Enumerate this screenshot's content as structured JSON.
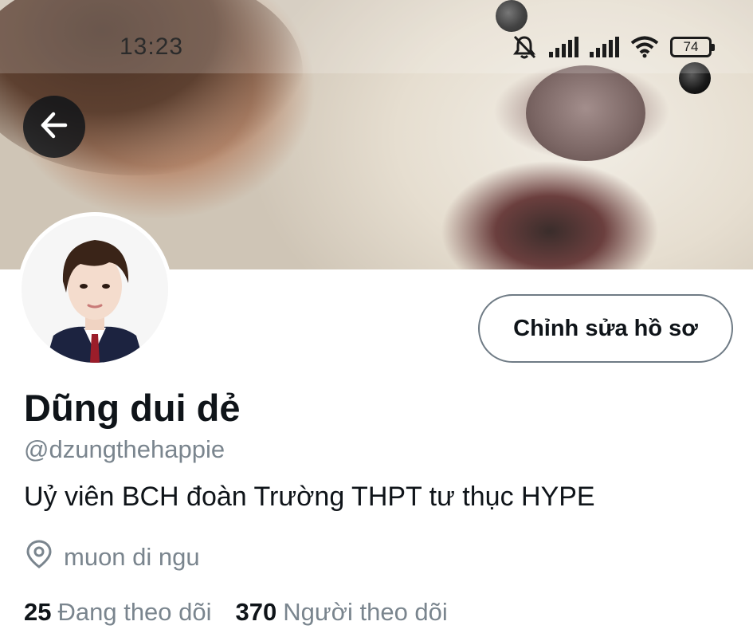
{
  "status_bar": {
    "time": "13:23",
    "battery": "74",
    "icons": [
      "bell-off-icon",
      "signal-icon",
      "signal-icon",
      "wifi-icon",
      "battery-icon"
    ]
  },
  "header": {
    "back_icon": "arrow-left-icon"
  },
  "profile": {
    "edit_button_label": "Chỉnh sửa hồ sơ",
    "display_name": "Dũng dui dẻ",
    "handle": "@dzungthehappie",
    "bio": "Uỷ viên BCH đoàn Trường THPT tư thục HYPE",
    "location_icon": "location-pin-icon",
    "location": "muon di ngu",
    "following_count": "25",
    "following_label": "Đang theo dõi",
    "followers_count": "370",
    "followers_label": "Người theo dõi"
  },
  "colors": {
    "text_primary": "#0f1419",
    "text_secondary": "#7a858e",
    "button_border": "#6f7b85"
  }
}
